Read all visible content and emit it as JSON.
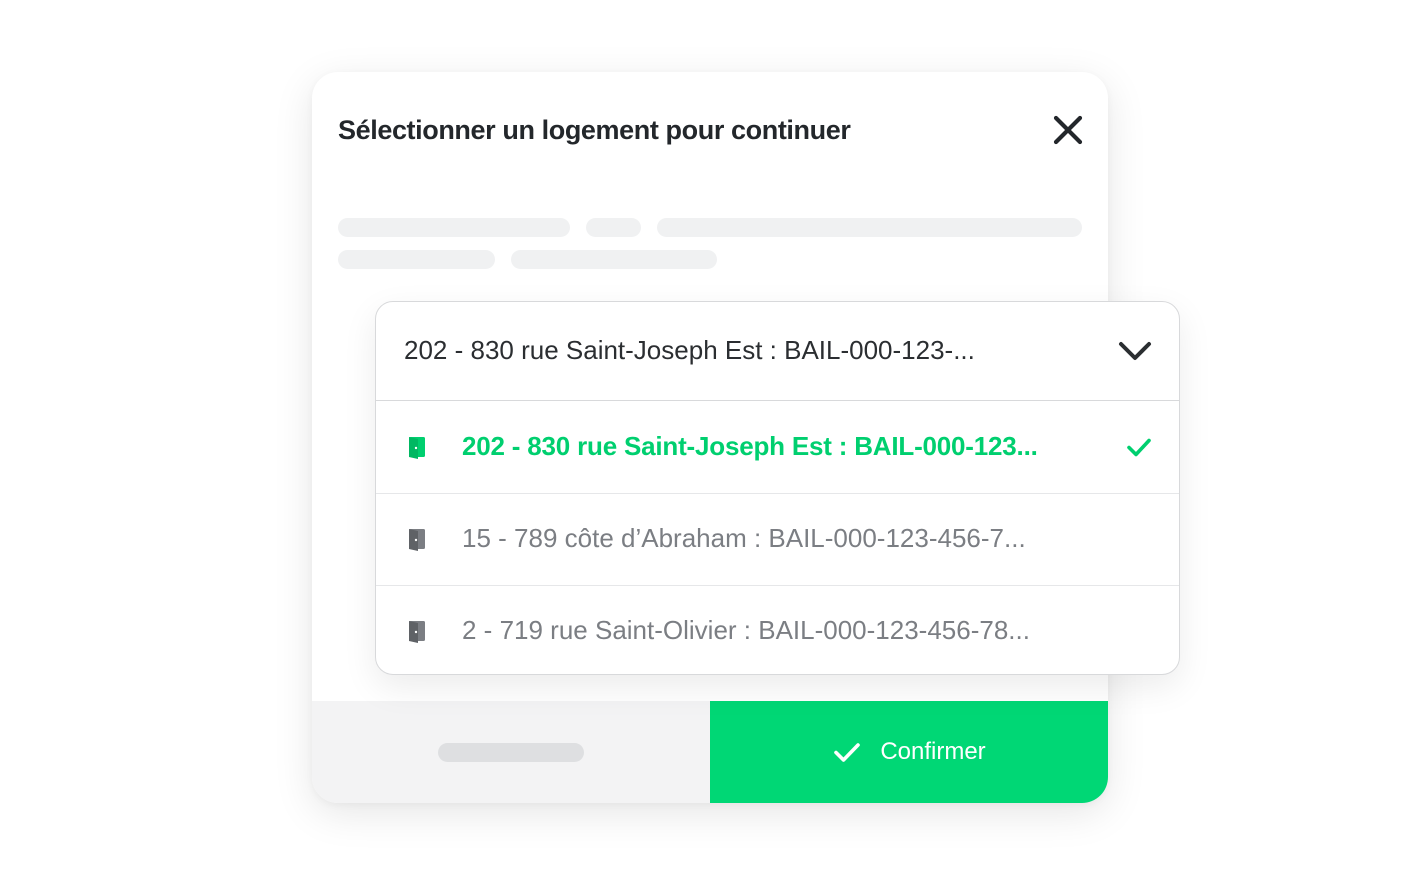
{
  "modal": {
    "title": "Sélectionner un logement pour continuer",
    "confirm_label": "Confirmer"
  },
  "select": {
    "value": "202 - 830 rue Saint-Joseph Est : BAIL-000-123-...",
    "options": [
      {
        "label": "202 - 830 rue Saint-Joseph Est : BAIL-000-123...",
        "selected": true
      },
      {
        "label": "15 - 789 côte d’Abraham : BAIL-000-123-456-7...",
        "selected": false
      },
      {
        "label": "2 - 719 rue Saint-Olivier : BAIL-000-123-456-78...",
        "selected": false
      }
    ]
  },
  "icons": {
    "close": "close-icon",
    "chevron": "chevron-down-icon",
    "door": "door-icon",
    "check": "check-icon"
  },
  "colors": {
    "accent": "#00d775",
    "selected_text": "#00cf6f",
    "title_text": "#23272b",
    "muted_text": "#7b7e83",
    "skeleton": "#f0f1f2"
  }
}
